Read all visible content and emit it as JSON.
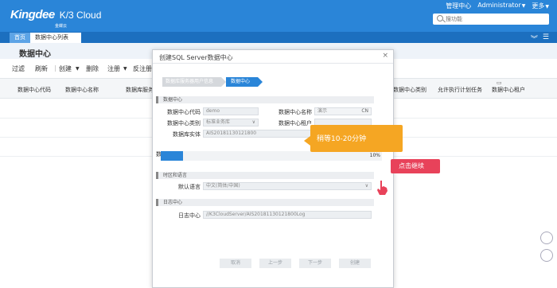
{
  "app": {
    "brand": "Kingdee",
    "product": "K/3 Cloud",
    "brand_cn": "金蝶云"
  },
  "top_links": {
    "admin_center": "管理中心",
    "user": "Administrator",
    "more": "更多"
  },
  "search": {
    "placeholder": "搜功能"
  },
  "tabs": [
    {
      "label": "首页"
    },
    {
      "label": "数据中心列表",
      "close": "✕"
    }
  ],
  "page": {
    "title": "数据中心"
  },
  "toolbar": [
    "过滤",
    "刷新",
    "创建",
    "删除",
    "注册",
    "反注册"
  ],
  "grid_headers": [
    "数据中心代码",
    "数据中心名称",
    "数据库服务",
    "数据中心类别",
    "允许执行计划任务",
    "数据中心租户"
  ],
  "modal": {
    "title": "创建SQL Server数据中心",
    "close": "×",
    "steps": [
      "数据库服务器用户信息",
      "数据中心"
    ],
    "section_datacenter": "数据中心",
    "fields": {
      "code_label": "数据中心代码",
      "code_value": "demo",
      "name_label": "数据中心名称",
      "name_value": "演示",
      "name_lang": "CN",
      "type_label": "数据中心类别",
      "type_value": "标准业务库",
      "tenant_label": "数据中心租户",
      "tenant_value": "",
      "entity_label": "数据库实体",
      "entity_value": "AIS20181130121800"
    },
    "progress": {
      "label": "数",
      "percent_text": "10%",
      "value": 0.1
    },
    "section_locale": "时区和语言",
    "language_label": "默认语言",
    "language_value": "中文(简体/中国)",
    "section_log": "日志中心",
    "log_label": "日志中心",
    "log_value": "//K3CloudServer/AIS20181130121800Log",
    "buttons": [
      "取消",
      "上一步",
      "下一步",
      "创建"
    ]
  },
  "annotations": {
    "wait_tip": "稍等10-20分钟",
    "continue_hint": "点击继续"
  }
}
